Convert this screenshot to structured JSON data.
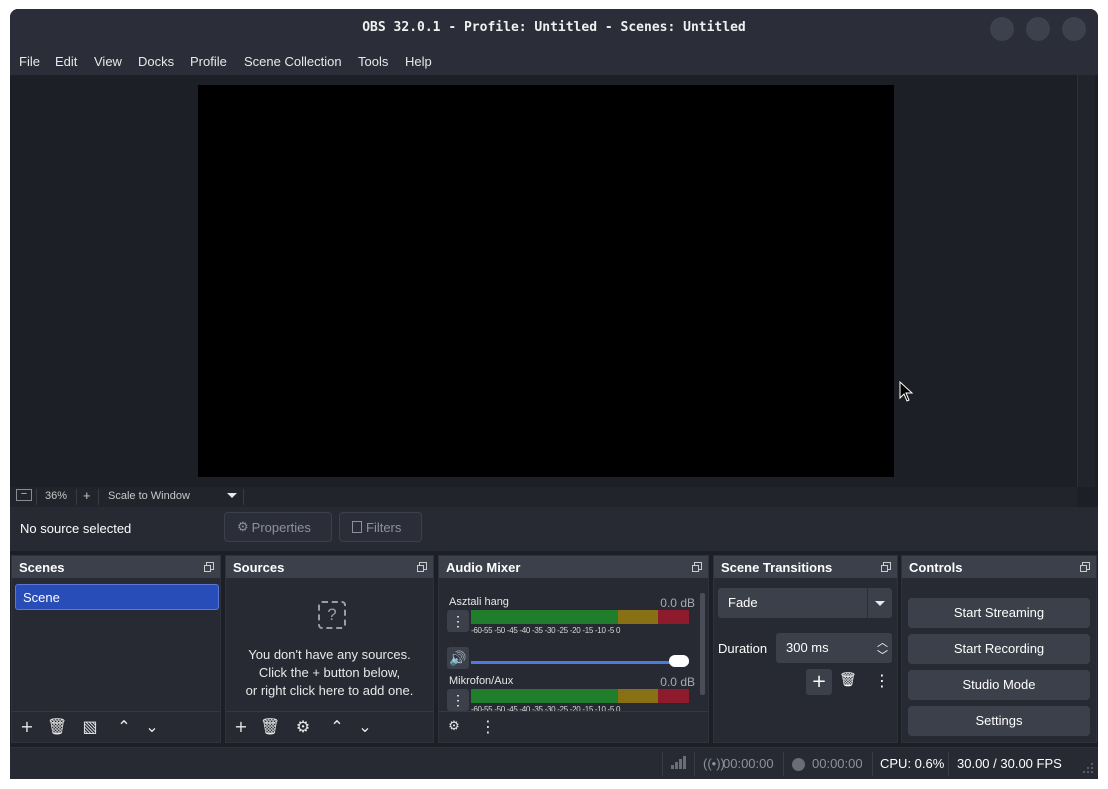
{
  "window": {
    "title": "OBS 32.0.1 - Profile: Untitled - Scenes: Untitled"
  },
  "menu": [
    "File",
    "Edit",
    "View",
    "Docks",
    "Profile",
    "Scene Collection",
    "Tools",
    "Help"
  ],
  "zoom": {
    "percent": "36%",
    "minus": "−",
    "plus": "+",
    "scale_mode": "Scale to Window"
  },
  "source_toolbar": {
    "status": "No source selected",
    "properties": "Properties",
    "filters": "Filters"
  },
  "docks": {
    "scenes": {
      "title": "Scenes",
      "items": [
        "Scene"
      ]
    },
    "sources": {
      "title": "Sources",
      "empty_line1": "You don't have any sources.",
      "empty_line2": "Click the + button below,",
      "empty_line3": "or right click here to add one."
    },
    "audio_mixer": {
      "title": "Audio Mixer",
      "channels": [
        {
          "name": "Asztali hang",
          "db": "0.0 dB"
        },
        {
          "name": "Mikrofon/Aux",
          "db": "0.0 dB"
        }
      ],
      "tick_labels": "-60-55 -50 -45 -40 -35 -30 -25 -20 -15 -10  -5   0"
    },
    "transitions": {
      "title": "Scene Transitions",
      "selected": "Fade",
      "duration_label": "Duration",
      "duration_value": "300 ms"
    },
    "controls": {
      "title": "Controls",
      "buttons": [
        "Start Streaming",
        "Start Recording",
        "Studio Mode",
        "Settings"
      ]
    }
  },
  "status": {
    "stream_time": "00:00:00",
    "record_time": "00:00:00",
    "cpu": "CPU: 0.6%",
    "fps": "30.00 / 30.00 FPS"
  },
  "icons": [
    "gear-icon",
    "filters-icon",
    "plus-icon",
    "trash-icon",
    "chevron-up-icon",
    "chevron-down-icon",
    "speaker-icon",
    "kebab-icon",
    "question-icon",
    "signal-icon",
    "record-icon",
    "stream-icon"
  ]
}
